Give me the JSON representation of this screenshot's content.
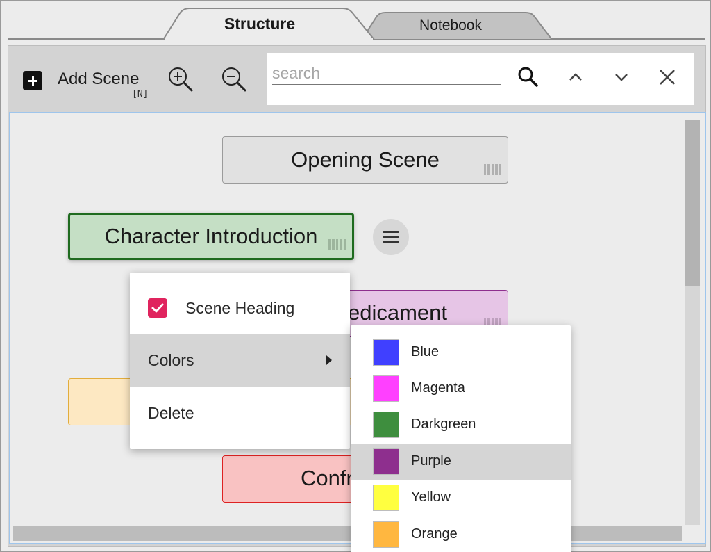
{
  "tabs": [
    {
      "label": "Structure",
      "active": true
    },
    {
      "label": "Notebook",
      "active": false
    }
  ],
  "toolbar": {
    "add_scene_label": "Add Scene",
    "add_scene_shortcut": "[N]",
    "zoom_in_icon": "zoom-in-icon",
    "zoom_out_icon": "zoom-out-icon"
  },
  "search": {
    "placeholder": "search",
    "value": ""
  },
  "scenes": [
    {
      "label": "Opening Scene",
      "color": "#e1e1e1"
    },
    {
      "label": "Character Introduction",
      "color": "#c5dfc5"
    },
    {
      "label": "edicament",
      "color": "#e6c5e6"
    },
    {
      "label": "",
      "color": "#fde8c2"
    },
    {
      "label": "Confr",
      "color": "#f9c2c2"
    }
  ],
  "context_menu": {
    "heading_label": "Scene Heading",
    "heading_checked": true,
    "colors_label": "Colors",
    "delete_label": "Delete"
  },
  "colors_submenu": [
    {
      "label": "Blue",
      "color": "#4040ff"
    },
    {
      "label": "Magenta",
      "color": "#ff40ff"
    },
    {
      "label": "Darkgreen",
      "color": "#3e8e3e"
    },
    {
      "label": "Purple",
      "color": "#8e2f8e",
      "highlighted": true
    },
    {
      "label": "Yellow",
      "color": "#ffff40"
    },
    {
      "label": "Orange",
      "color": "#ffb740"
    }
  ],
  "colors": {
    "accent": "#e0245e",
    "focus_border": "#9ec5ec"
  }
}
